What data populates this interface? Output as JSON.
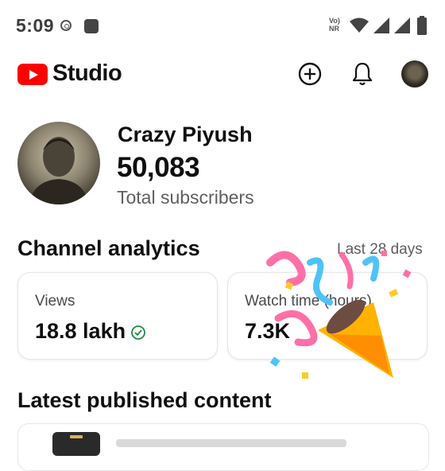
{
  "status_bar": {
    "time": "5:09",
    "network_label_top": "Vo)",
    "network_label_bottom": "NR",
    "icons": [
      "wifi-icon",
      "signal-icon",
      "signal-icon",
      "battery-icon"
    ]
  },
  "header": {
    "app_name": "Studio",
    "brand_color": "#ff0000",
    "icons": [
      "create-icon",
      "notifications-bell-icon",
      "account-avatar"
    ]
  },
  "profile": {
    "channel_name": "Crazy Piyush",
    "subscriber_count": "50,083",
    "subscriber_label": "Total subscribers"
  },
  "analytics": {
    "title": "Channel analytics",
    "period": "Last 28 days",
    "cards": [
      {
        "label": "Views",
        "value": "18.8 lakh",
        "status_icon": "check-circle-icon",
        "status_color": "#1a8f3c"
      },
      {
        "label": "Watch time (hours)",
        "value": "7.3K"
      }
    ]
  },
  "latest": {
    "title": "Latest published content"
  },
  "overlay": {
    "icon": "party-popper-icon"
  }
}
